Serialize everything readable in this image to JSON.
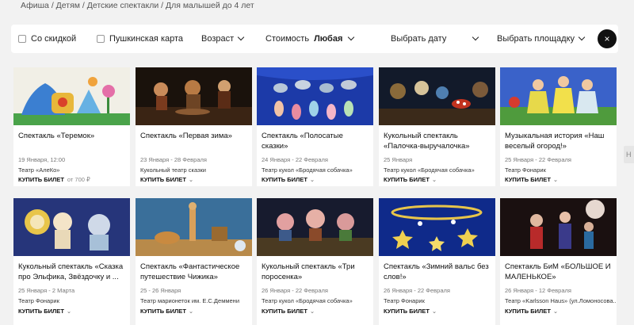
{
  "breadcrumb": [
    "Афиша",
    "Детям",
    "Детские спектакли",
    "Для малышей до 4 лет"
  ],
  "breadcrumb_sep": "/",
  "filters": {
    "discount": "Со скидкой",
    "pushkin": "Пушкинская карта",
    "age": "Возраст",
    "price_label": "Стоимость",
    "price_value": "Любая",
    "date": "Выбрать дату",
    "venue": "Выбрать площадку",
    "close": "×"
  },
  "side_tab": "Н",
  "buy_label": "КУПИТЬ БИЛЕТ",
  "cards": [
    {
      "title": "Спектакль «Теремок»",
      "date": "19 Января, 12:00",
      "venue": "Театр «АлеКо»",
      "price": "от 700 ₽"
    },
    {
      "title": "Спектакль «Первая зима»",
      "date": "23 Января - 28 Февраля",
      "venue": "Кукольный театр сказки",
      "price": ""
    },
    {
      "title": "Спектакль «Полосатые сказки»",
      "date": "24 Января - 22 Февраля",
      "venue": "Театр кукол «Бродячая собачка»",
      "price": ""
    },
    {
      "title": "Кукольный спектакль «Палочка-выручалочка»",
      "date": "25 Января",
      "venue": "Театр кукол «Бродячая собачка»",
      "price": ""
    },
    {
      "title": "Музыкальная история «Наш веселый огород!»",
      "date": "25 Января - 22 Февраля",
      "venue": "Театр Фонарик",
      "price": ""
    },
    {
      "title": "Кукольный спектакль «Сказка про Эльфика, Звёздочку и ...",
      "date": "25 Января - 2 Марта",
      "venue": "Театр Фонарик",
      "price": ""
    },
    {
      "title": "Спектакль «Фантастическое путешествие Чижика»",
      "date": "25 - 26 Января",
      "venue": "Театр марионеток им. Е.С.Деммени",
      "price": ""
    },
    {
      "title": "Кукольный спектакль «Три поросенка»",
      "date": "26 Января - 22 Февраля",
      "venue": "Театр кукол «Бродячая собачка»",
      "price": ""
    },
    {
      "title": "Спектакль «Зимний вальс без слов!»",
      "date": "26 Января - 22 Февраля",
      "venue": "Театр Фонарик",
      "price": ""
    },
    {
      "title": "Спектакль БиМ «БОЛЬШОЕ И МАЛЕНЬКОЕ»",
      "date": "26 Января - 12 Февраля",
      "venue": "Театр «Karlsson Haus» (ул.Ломоносова...",
      "price": ""
    }
  ]
}
